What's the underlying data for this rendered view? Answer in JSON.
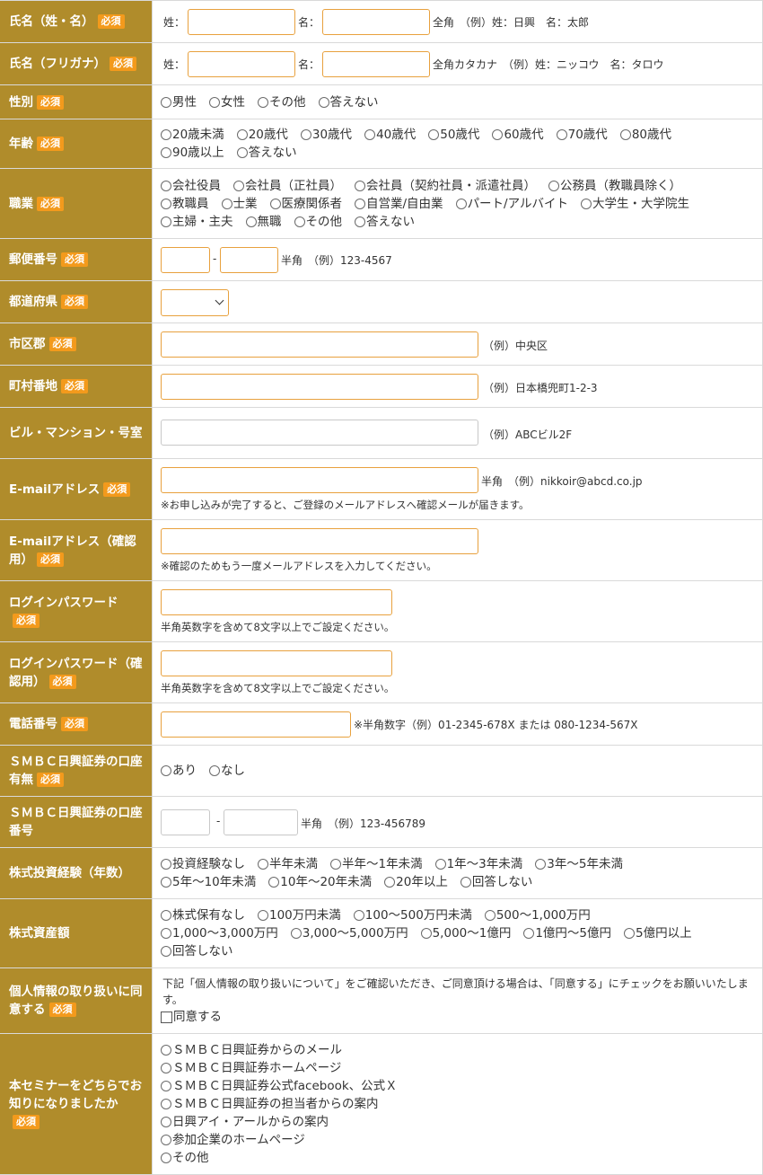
{
  "required_badge": "必須",
  "name": {
    "label": "氏名（姓・名）",
    "sei": "姓：",
    "mei": "名：",
    "note": "全角　（例）姓：日興　名：太郎"
  },
  "kana": {
    "label": "氏名（フリガナ）",
    "sei": "姓：",
    "mei": "名：",
    "note": "全角カタカナ　（例）姓：ニッコウ　名：タロウ"
  },
  "gender": {
    "label": "性別",
    "options": [
      "男性",
      "女性",
      "その他",
      "答えない"
    ]
  },
  "age": {
    "label": "年齢",
    "options": [
      "20歳未満",
      "20歳代",
      "30歳代",
      "40歳代",
      "50歳代",
      "60歳代",
      "70歳代",
      "80歳代",
      "90歳以上",
      "答えない"
    ]
  },
  "job": {
    "label": "職業",
    "options": [
      "会社役員",
      "会社員（正社員）",
      "会社員（契約社員・派遣社員）",
      "公務員（教職員除く）",
      "教職員",
      "士業",
      "医療関係者",
      "自営業/自由業",
      "パート/アルバイト",
      "大学生・大学院生",
      "主婦・主夫",
      "無職",
      "その他",
      "答えない"
    ]
  },
  "postal": {
    "label": "郵便番号",
    "dash": "-",
    "note": "半角　（例）123-4567"
  },
  "prefecture": {
    "label": "都道府県",
    "value": ""
  },
  "city": {
    "label": "市区郡",
    "note": "（例）中央区"
  },
  "town": {
    "label": "町村番地",
    "note": "（例）日本橋兜町1-2-3"
  },
  "building": {
    "label": "ビル・マンション・号室",
    "note": "（例）ABCビル2F"
  },
  "email": {
    "label": "E-mailアドレス",
    "note": "半角　（例）nikkoir@abcd.co.jp",
    "sub": "※お申し込みが完了すると、ご登録のメールアドレスへ確認メールが届きます。"
  },
  "email_confirm": {
    "label": "E-mailアドレス（確認用）",
    "sub": "※確認のためもう一度メールアドレスを入力してください。"
  },
  "password": {
    "label": "ログインパスワード",
    "sub": "半角英数字を含めて8文字以上でご設定ください。"
  },
  "password_confirm": {
    "label": "ログインパスワード（確認用）",
    "sub": "半角英数字を含めて8文字以上でご設定ください。"
  },
  "phone": {
    "label": "電話番号",
    "note": "※半角数字（例）01-2345-678X または 080-1234-567X"
  },
  "smbc_account": {
    "label": "ＳＭＢＣ日興証券の口座有無",
    "options": [
      "あり",
      "なし"
    ]
  },
  "smbc_number": {
    "label": "ＳＭＢＣ日興証券の口座番号",
    "dash": "-",
    "note": "半角　（例）123-456789"
  },
  "experience": {
    "label": "株式投資経験（年数）",
    "options": [
      "投資経験なし",
      "半年未満",
      "半年～1年未満",
      "1年～3年未満",
      "3年～5年未満",
      "5年～10年未満",
      "10年～20年未満",
      "20年以上",
      "回答しない"
    ]
  },
  "assets": {
    "label": "株式資産額",
    "options": [
      "株式保有なし",
      "100万円未満",
      "100～500万円未満",
      "500～1,000万円",
      "1,000～3,000万円",
      "3,000～5,000万円",
      "5,000～1億円",
      "1億円～5億円",
      "5億円以上",
      "回答しない"
    ]
  },
  "privacy": {
    "label": "個人情報の取り扱いに同意する",
    "text": "下記「個人情報の取り扱いについて」をご確認いただき、ご同意頂ける場合は、「同意する」にチェックをお願いいたします。",
    "checkbox": "同意する"
  },
  "source": {
    "label": "本セミナーをどちらでお知りになりましたか",
    "options": [
      "ＳＭＢＣ日興証券からのメール",
      "ＳＭＢＣ日興証券ホームページ",
      "ＳＭＢＣ日興証券公式facebook、公式Ｘ",
      "ＳＭＢＣ日興証券の担当者からの案内",
      "日興アイ・アールからの案内",
      "参加企業のホームページ",
      "その他"
    ]
  }
}
